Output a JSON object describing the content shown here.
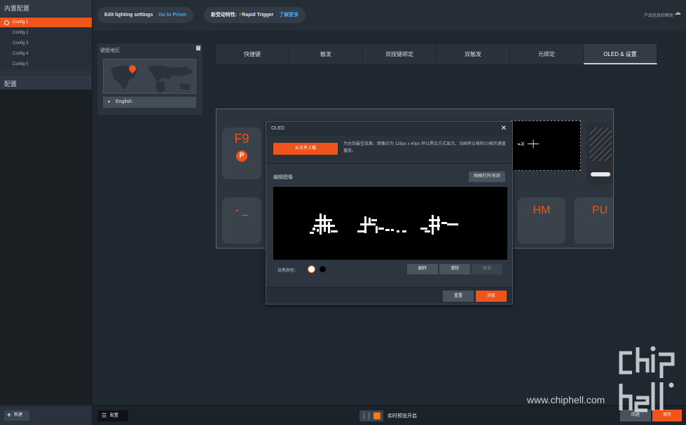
{
  "sidebar": {
    "builtin_header": "内置配置",
    "configs": [
      "Config 1",
      "Config 2",
      "Config 3",
      "Config 4",
      "Config 5"
    ],
    "active_config": 0,
    "profiles_header": "配置",
    "new_label": "新建"
  },
  "topbar": {
    "lighting_text": "Edit lighting settings",
    "lighting_link": "Go to Prism",
    "feature_text": "新受动特性:",
    "feature_name": "Rapid Trigger",
    "feature_link": "了解更多",
    "help_text": "产品信息和帮助"
  },
  "region": {
    "title": "键盘地区",
    "language": "English"
  },
  "tabs": [
    "快捷键",
    "触发",
    "双按键绑定",
    "双触发",
    "元绑定",
    "OLED & 设置"
  ],
  "active_tab": 5,
  "keyboard": {
    "key_f9": "F9",
    "key_p": "P",
    "key_minus": "- _",
    "key_hm": "HM",
    "key_pu": "PU"
  },
  "dialog": {
    "title": "OLED",
    "upload_label": "从文件上载",
    "upload_hint": "为达到最佳效果，图像应为 128px x 40px 并以黑白方式显示。动画将以每秒10帧的速度播放。",
    "edit_title": "编辑图像",
    "grid_toggle": "网格打开/关闭",
    "brush_label": "铅笔颜色：",
    "flip_label": "翻转",
    "clear_label": "清除",
    "cancel_label": "取消",
    "reset_label": "重置",
    "browse_label": "浏览"
  },
  "bottombar": {
    "profile_label": "配置",
    "preview_label": "实时预览开启",
    "back_label": "回退",
    "save_label": "保存"
  },
  "watermark": {
    "site": "www.chiphell.com",
    "logo_text": "chip hell"
  },
  "colors": {
    "accent": "#f0541a",
    "link": "#4ea8f0"
  }
}
